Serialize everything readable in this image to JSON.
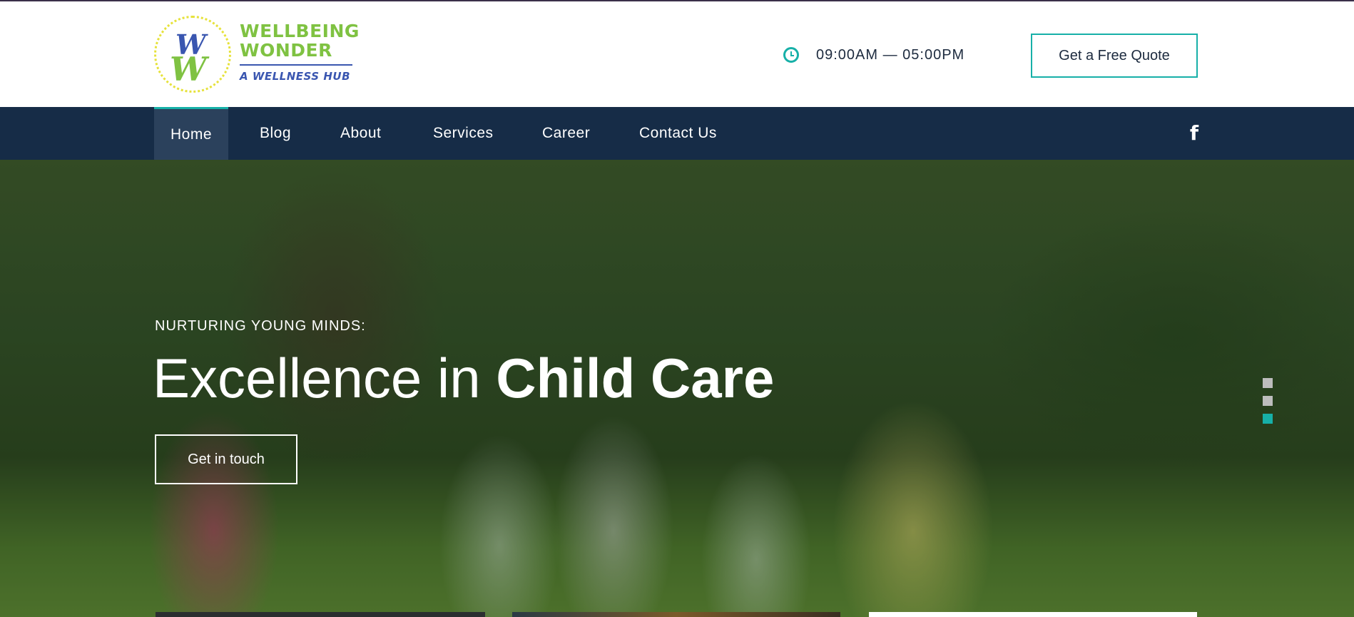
{
  "brand": {
    "name_line1": "WELLBEING",
    "name_line2": "WONDER",
    "tagline": "A WELLNESS HUB",
    "mark_top": "W",
    "mark_bottom": "W",
    "colors": {
      "green": "#7fc242",
      "blue": "#3a56b0",
      "ring": "#e6e23a"
    }
  },
  "header": {
    "hours_icon": "clock-icon",
    "hours": "09:00AM — 05:00PM",
    "cta_label": "Get a Free Quote"
  },
  "nav": {
    "items": [
      {
        "label": "Home",
        "active": true
      },
      {
        "label": "Blog"
      },
      {
        "label": "About"
      },
      {
        "label": "Services"
      },
      {
        "label": "Career"
      },
      {
        "label": "Contact Us"
      }
    ],
    "social_icon": "facebook-icon",
    "social_glyph": "f"
  },
  "hero": {
    "kicker": "NURTURING YOUNG MINDS:",
    "title_light": "Excellence in ",
    "title_bold": "Child Care",
    "button_label": "Get in touch",
    "slides_total": 3,
    "active_slide": 3
  },
  "colors": {
    "accent": "#17b0a8",
    "nav_bg": "#162c47",
    "nav_active_bg": "#2b415c",
    "text_dark": "#1c2a3e"
  }
}
